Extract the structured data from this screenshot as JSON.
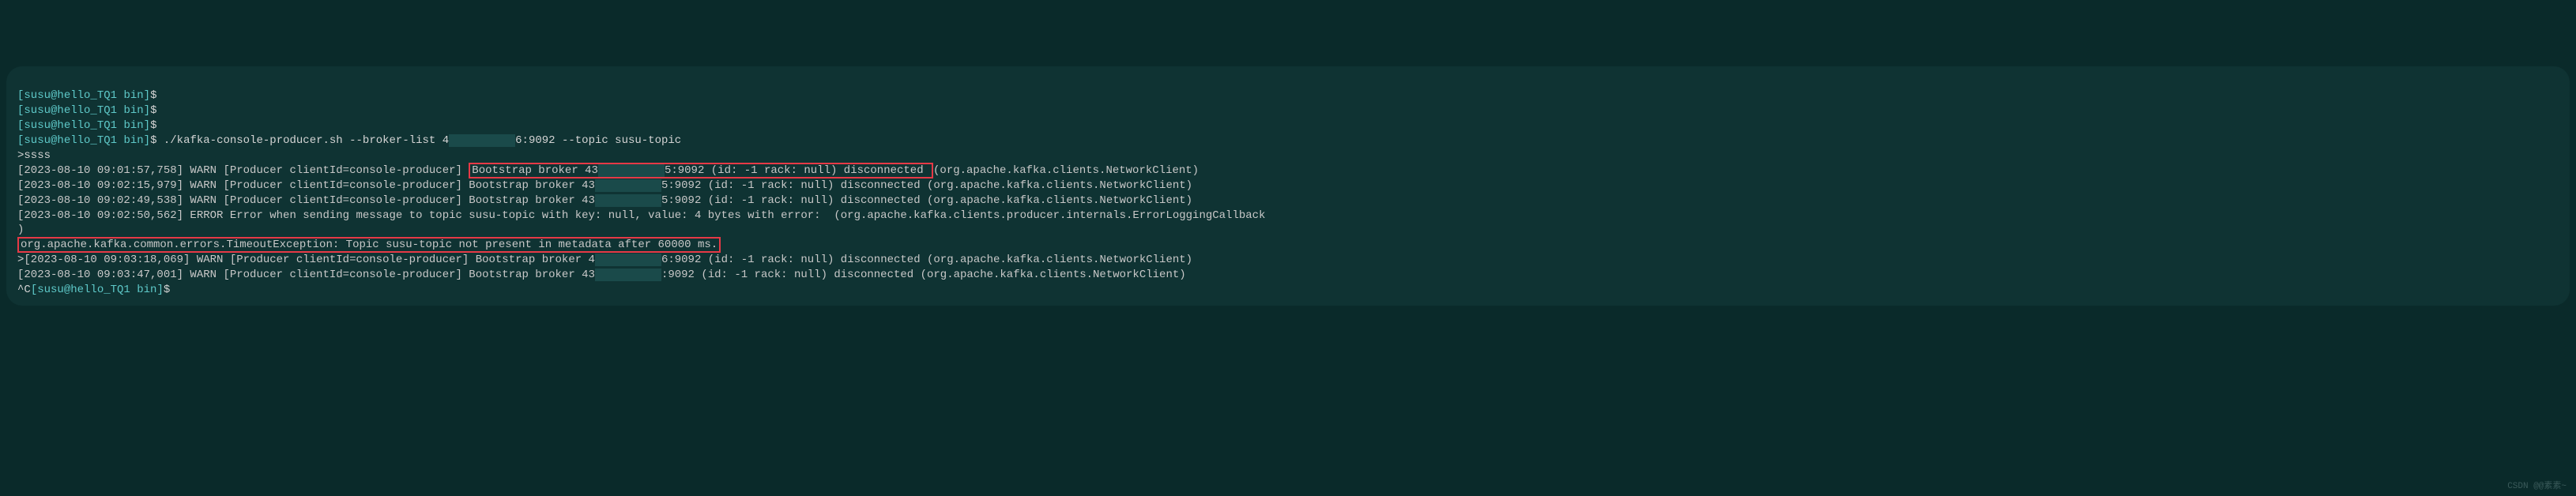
{
  "prompt": {
    "open": "[",
    "user": "susu@hello_TQ1",
    "space": " ",
    "path": "bin",
    "close": "]",
    "dollar": "$"
  },
  "lines": {
    "cmd_empty": " ",
    "cmd_producer": " ./kafka-console-producer.sh --broker-list 4",
    "cmd_producer_redacted": "          ",
    "cmd_producer_tail": "6:9092 --topic susu-topic",
    "input_line": ">ssss",
    "caret_prompt_prefix": "^C"
  },
  "logs": {
    "l1_a": "[2023-08-10 09:01:57,758] WARN [Producer clientId=console-producer] ",
    "l1_box": "Bootstrap broker 43",
    "l1_redacted": "          ",
    "l1_box_tail": "5:9092 (id: -1 rack: null) disconnected ",
    "l1_suffix": "(org.apache.kafka.clients.NetworkClient)",
    "l2_a": "[2023-08-10 09:02:15,979] WARN [Producer clientId=console-producer] Bootstrap broker 43",
    "l2_redacted": "          ",
    "l2_tail": "5:9092 (id: -1 rack: null) disconnected (org.apache.kafka.clients.NetworkClient)",
    "l3_a": "[2023-08-10 09:02:49,538] WARN [Producer clientId=console-producer] Bootstrap broker 43",
    "l3_redacted": "          ",
    "l3_tail": "5:9092 (id: -1 rack: null) disconnected (org.apache.kafka.clients.NetworkClient)",
    "l4": "[2023-08-10 09:02:50,562] ERROR Error when sending message to topic susu-topic with key: null, value: 4 bytes with error:  (org.apache.kafka.clients.producer.internals.ErrorLoggingCallback",
    "l4_paren": ")",
    "l5_box": "org.apache.kafka.common.errors.TimeoutException: Topic susu-topic not present in metadata after 60000 ms.",
    "l6_prefix": ">",
    "l6_a": "[2023-08-10 09:03:18,069] WARN [Producer clientId=console-producer] Bootstrap broker 4",
    "l6_redacted": "          ",
    "l6_tail": "6:9092 (id: -1 rack: null) disconnected (org.apache.kafka.clients.NetworkClient)",
    "l7_a": "[2023-08-10 09:03:47,001] WARN [Producer clientId=console-producer] Bootstrap broker 43",
    "l7_redacted": "          ",
    "l7_tail": ":9092 (id: -1 rack: null) disconnected (org.apache.kafka.clients.NetworkClient)"
  },
  "watermark": "CSDN @@素素~"
}
